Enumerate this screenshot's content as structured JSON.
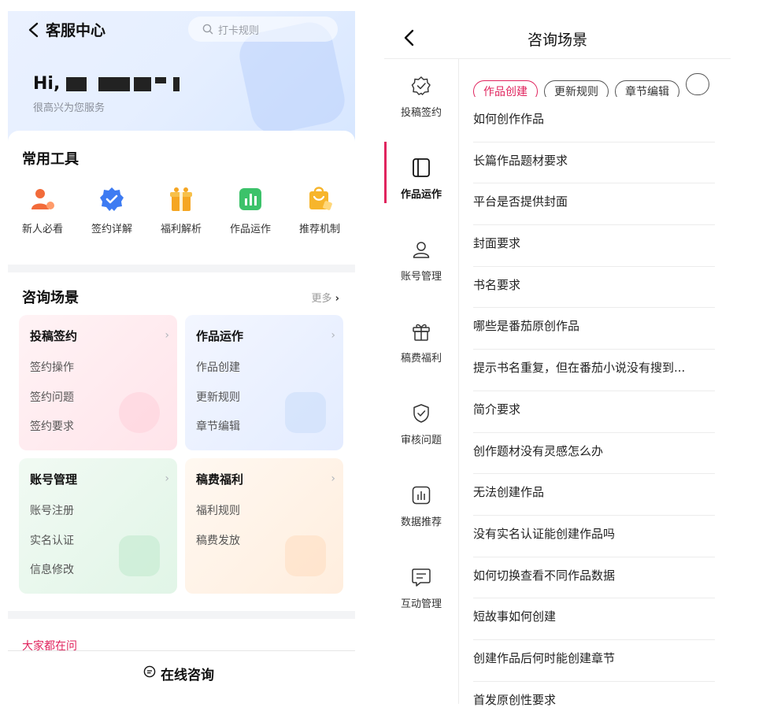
{
  "left": {
    "title": "客服中心",
    "search_placeholder": "打卡规则",
    "greeting": "Hi,",
    "subtitle": "很高兴为您服务",
    "tools_title": "常用工具",
    "tools": [
      {
        "label": "新人必看",
        "icon": "new-user-icon",
        "color": "#f26b3a"
      },
      {
        "label": "签约详解",
        "icon": "verified-badge-icon",
        "color": "#3d7bf2"
      },
      {
        "label": "福利解析",
        "icon": "gift-icon",
        "color": "#f5a623"
      },
      {
        "label": "作品运作",
        "icon": "chart-icon",
        "color": "#3cc26a"
      },
      {
        "label": "推荐机制",
        "icon": "shopping-bag-icon",
        "color": "#f7b52c"
      }
    ],
    "scene_title": "咨询场景",
    "more_label": "更多",
    "tiles": [
      {
        "title": "投稿签约",
        "items": [
          "签约操作",
          "签约问题",
          "签约要求"
        ]
      },
      {
        "title": "作品运作",
        "items": [
          "作品创建",
          "更新规则",
          "章节编辑"
        ]
      },
      {
        "title": "账号管理",
        "items": [
          "账号注册",
          "实名认证",
          "信息修改"
        ]
      },
      {
        "title": "稿费福利",
        "items": [
          "福利规则",
          "稿费发放"
        ]
      }
    ],
    "ask_title": "大家都在问",
    "consult_label": "在线咨询"
  },
  "right": {
    "title": "咨询场景",
    "rail": [
      {
        "label": "投稿签约",
        "icon": "badge-check-icon"
      },
      {
        "label": "作品运作",
        "icon": "book-icon"
      },
      {
        "label": "账号管理",
        "icon": "user-icon"
      },
      {
        "label": "稿费福利",
        "icon": "gift-icon"
      },
      {
        "label": "审核问题",
        "icon": "shield-check-icon"
      },
      {
        "label": "数据推荐",
        "icon": "bar-chart-icon"
      },
      {
        "label": "互动管理",
        "icon": "message-icon"
      }
    ],
    "active_rail": "作品运作",
    "chips": [
      "作品创建",
      "更新规则",
      "章节编辑",
      ""
    ],
    "active_chip": "作品创建",
    "questions": [
      "如何创作作品",
      "长篇作品题材要求",
      "平台是否提供封面",
      "封面要求",
      "书名要求",
      "哪些是番茄原创作品",
      "提示书名重复，但在番茄小说没有搜到...",
      "简介要求",
      "创作题材没有灵感怎么办",
      "无法创建作品",
      "没有实名认证能创建作品吗",
      "如何切换查看不同作品数据",
      "短故事如何创建",
      "创建作品后何时能创建章节",
      "首发原创性要求"
    ],
    "accent_color": "#e0245e"
  }
}
